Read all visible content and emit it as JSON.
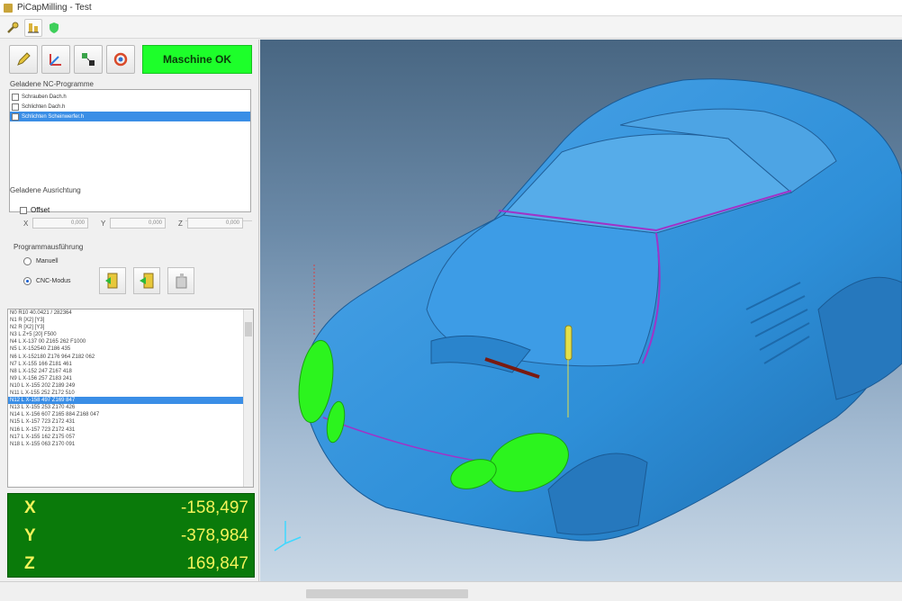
{
  "window": {
    "title": "PiCapMilling - Test"
  },
  "machine_status": {
    "label": "Maschine OK",
    "color": "#1dff2a"
  },
  "programs": {
    "group_label": "Geladene NC-Programme",
    "items": [
      {
        "label": "Schrauben Dach.h",
        "checked": false,
        "selected": false
      },
      {
        "label": "Schlichten Dach.h",
        "checked": false,
        "selected": false
      },
      {
        "label": "Schlichten Scheinwerfer.h",
        "checked": true,
        "selected": true
      }
    ]
  },
  "alignment": {
    "group_label": "Geladene Ausrichtung",
    "offset_label": "Offset",
    "x_label": "X",
    "y_label": "Y",
    "z_label": "Z",
    "x_value": "0,000",
    "y_value": "0,000",
    "z_value": "0,000"
  },
  "execution": {
    "group_label": "Programmausführung",
    "manual_label": "Manuell",
    "cnc_label": "CNC-Modus",
    "mode": "cnc"
  },
  "nc_program": {
    "lines": [
      "N0 R10 40.0421 / 282364",
      "N1 R [X2] [Y3]",
      "N2 R [X2] [Y3]",
      "N3 L Z+5 [20] F500",
      "N4 L X-137 00 Z165 262 F1000",
      "N5 L X-152540 Z186 435",
      "N6 L X-152180 Z176 964 Z182 062",
      "N7 L X-155 166 Z181 461",
      "N8 L X-152 247 Z167 418",
      "N9 L X-156 257 Z183 241",
      "N10 L X-155 202 Z189 249",
      "N11 L X-155 252 Z172 510",
      "N12 L X-158 497 Z169 847",
      "N13 L X-155 253 Z170 426",
      "N14 L X-156 607 Z165 884 Z168 047",
      "N15 L X-157 723 Z172 431",
      "N16 L X-157 723 Z172 431",
      "N17 L X-155 162 Z175 057",
      "N18 L X-155 063 Z170 091"
    ],
    "current_index": 12
  },
  "readout": {
    "x_axis": "X",
    "x_value": "-158,497",
    "y_axis": "Y",
    "y_value": "-378,984",
    "z_axis": "Z",
    "z_value": "169,847",
    "bg_color": "#0a7a0a",
    "text_color": "#f3f35a"
  },
  "colors": {
    "car_body": "#2e8fd8",
    "highlight": "#2cf41e",
    "toolpath": "#a033c8"
  },
  "icons": {
    "toolbar": [
      "wrench-icon",
      "measure-icon",
      "shield-icon"
    ],
    "commands": [
      "pencil-icon",
      "axis-icon",
      "align-icon",
      "refresh-icon"
    ],
    "execution": [
      "step-forward-icon",
      "play-icon",
      "stop-icon"
    ]
  }
}
